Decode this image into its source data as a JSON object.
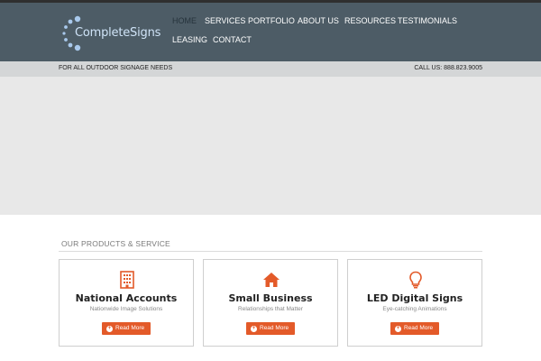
{
  "logo": {
    "text": "CompleteSigns",
    "icon": "dots-arc-logo"
  },
  "nav": {
    "items": [
      {
        "label": "HOME",
        "active": true
      },
      {
        "label": "SERVICES",
        "active": false
      },
      {
        "label": "PORTFOLIO",
        "active": false
      },
      {
        "label": "ABOUT US",
        "active": false
      },
      {
        "label": "RESOURCES",
        "active": false
      },
      {
        "label": "TESTIMONIALS",
        "active": false
      },
      {
        "label": "LEASING",
        "active": false
      },
      {
        "label": "CONTACT",
        "active": false
      }
    ]
  },
  "subbar": {
    "tagline": "FOR ALL OUTDOOR SIGNAGE NEEDS",
    "phone": "CALL US: 888.823.9005"
  },
  "products": {
    "section_title": "OUR PRODUCTS & SERVICE",
    "cards": [
      {
        "icon": "building-icon",
        "title": "National Accounts",
        "subtitle": "Nationwide Image Solutions",
        "button": "Read More"
      },
      {
        "icon": "home-icon",
        "title": "Small Business",
        "subtitle": "Relationships that Matter",
        "button": "Read More"
      },
      {
        "icon": "lightbulb-icon",
        "title": "LED Digital Signs",
        "subtitle": "Eye-catching Animations",
        "button": "Read More"
      }
    ]
  },
  "colors": {
    "header_bg": "#4d5c66",
    "accent": "#e35a29",
    "subbar_bg": "#d4d6d7",
    "hero_bg": "#e8e8e8"
  }
}
